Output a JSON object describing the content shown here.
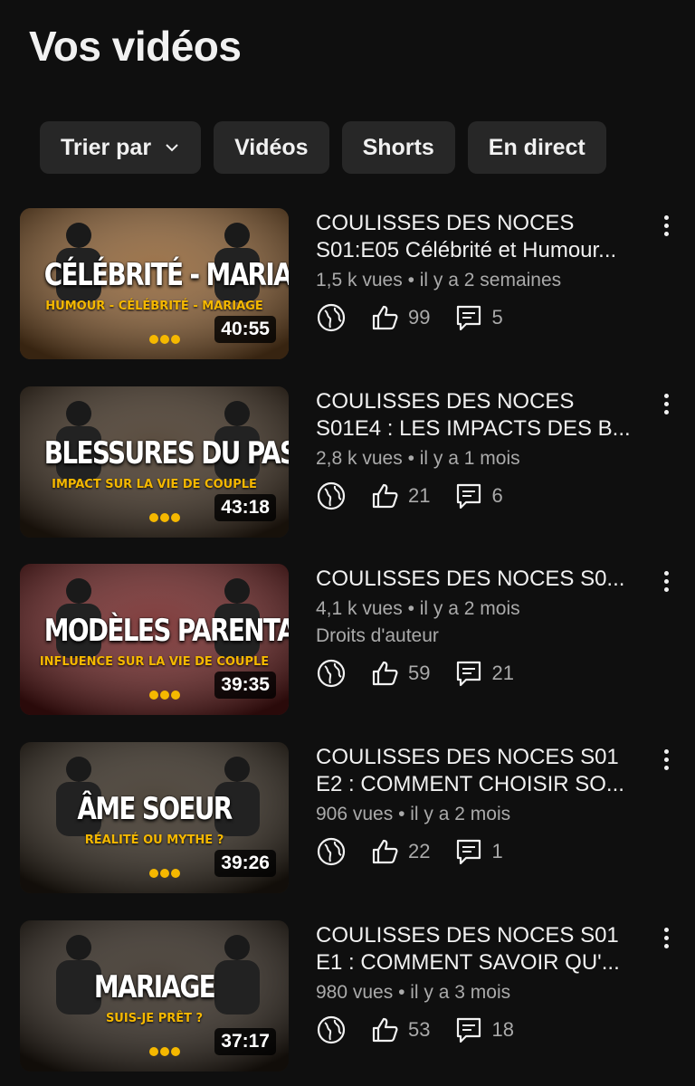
{
  "header": {
    "title": "Vos vidéos"
  },
  "filters": {
    "sort_label": "Trier par",
    "chips": [
      "Vidéos",
      "Shorts",
      "En direct"
    ]
  },
  "videos": [
    {
      "title_line1": "COULISSES DES NOCES",
      "title_line2": "S01:E05 Célébrité et Humour...",
      "views": "1,5 k vues",
      "age": "il y a 2 semaines",
      "extra": "",
      "likes": "99",
      "comments": "5",
      "duration": "40:55",
      "thumb_title": "CÉLÉBRITÉ - MARIAGE",
      "thumb_sub": "HUMOUR - CÉLÉBRITÉ - MARIAGE",
      "thumb_color": "#8a5a2a"
    },
    {
      "title_line1": "COULISSES DES NOCES",
      "title_line2": "S01E4 : LES IMPACTS DES B...",
      "views": "2,8 k vues",
      "age": "il y a 1 mois",
      "extra": "",
      "likes": "21",
      "comments": "6",
      "duration": "43:18",
      "thumb_title": "BLESSURES DU PASSÉ",
      "thumb_sub": "IMPACT SUR LA VIE DE COUPLE",
      "thumb_color": "#3a2a1a"
    },
    {
      "title_line1": "COULISSES DES NOCES  S0...",
      "title_line2": "",
      "views": "4,1 k vues",
      "age": "il y a 2 mois",
      "extra": "Droits d'auteur",
      "likes": "59",
      "comments": "21",
      "duration": "39:35",
      "thumb_title": "MODÈLES PARENTAUX",
      "thumb_sub": "INFLUENCE SUR LA VIE DE COUPLE",
      "thumb_color": "#6a1a1a"
    },
    {
      "title_line1": "COULISSES DES NOCES S01",
      "title_line2": "E2 : COMMENT CHOISIR SO...",
      "views": "906 vues",
      "age": "il y a 2 mois",
      "extra": "",
      "likes": "22",
      "comments": "1",
      "duration": "39:26",
      "thumb_title": "ÂME SOEUR",
      "thumb_sub": "RÉALITÉ OU MYTHE ?",
      "thumb_color": "#2e2418"
    },
    {
      "title_line1": "COULISSES DES NOCES S01",
      "title_line2": "E1 : COMMENT SAVOIR QU'...",
      "views": "980 vues",
      "age": "il y a 3 mois",
      "extra": "",
      "likes": "53",
      "comments": "18",
      "duration": "37:17",
      "thumb_title": "MARIAGE",
      "thumb_sub": "SUIS-JE PRÊT ?",
      "thumb_color": "#2a2016"
    }
  ],
  "icons": {
    "visibility": "globe-icon",
    "likes": "thumbs-up-icon",
    "comments": "comment-icon",
    "menu": "more-vertical-icon",
    "sort": "chevron-down-icon"
  }
}
